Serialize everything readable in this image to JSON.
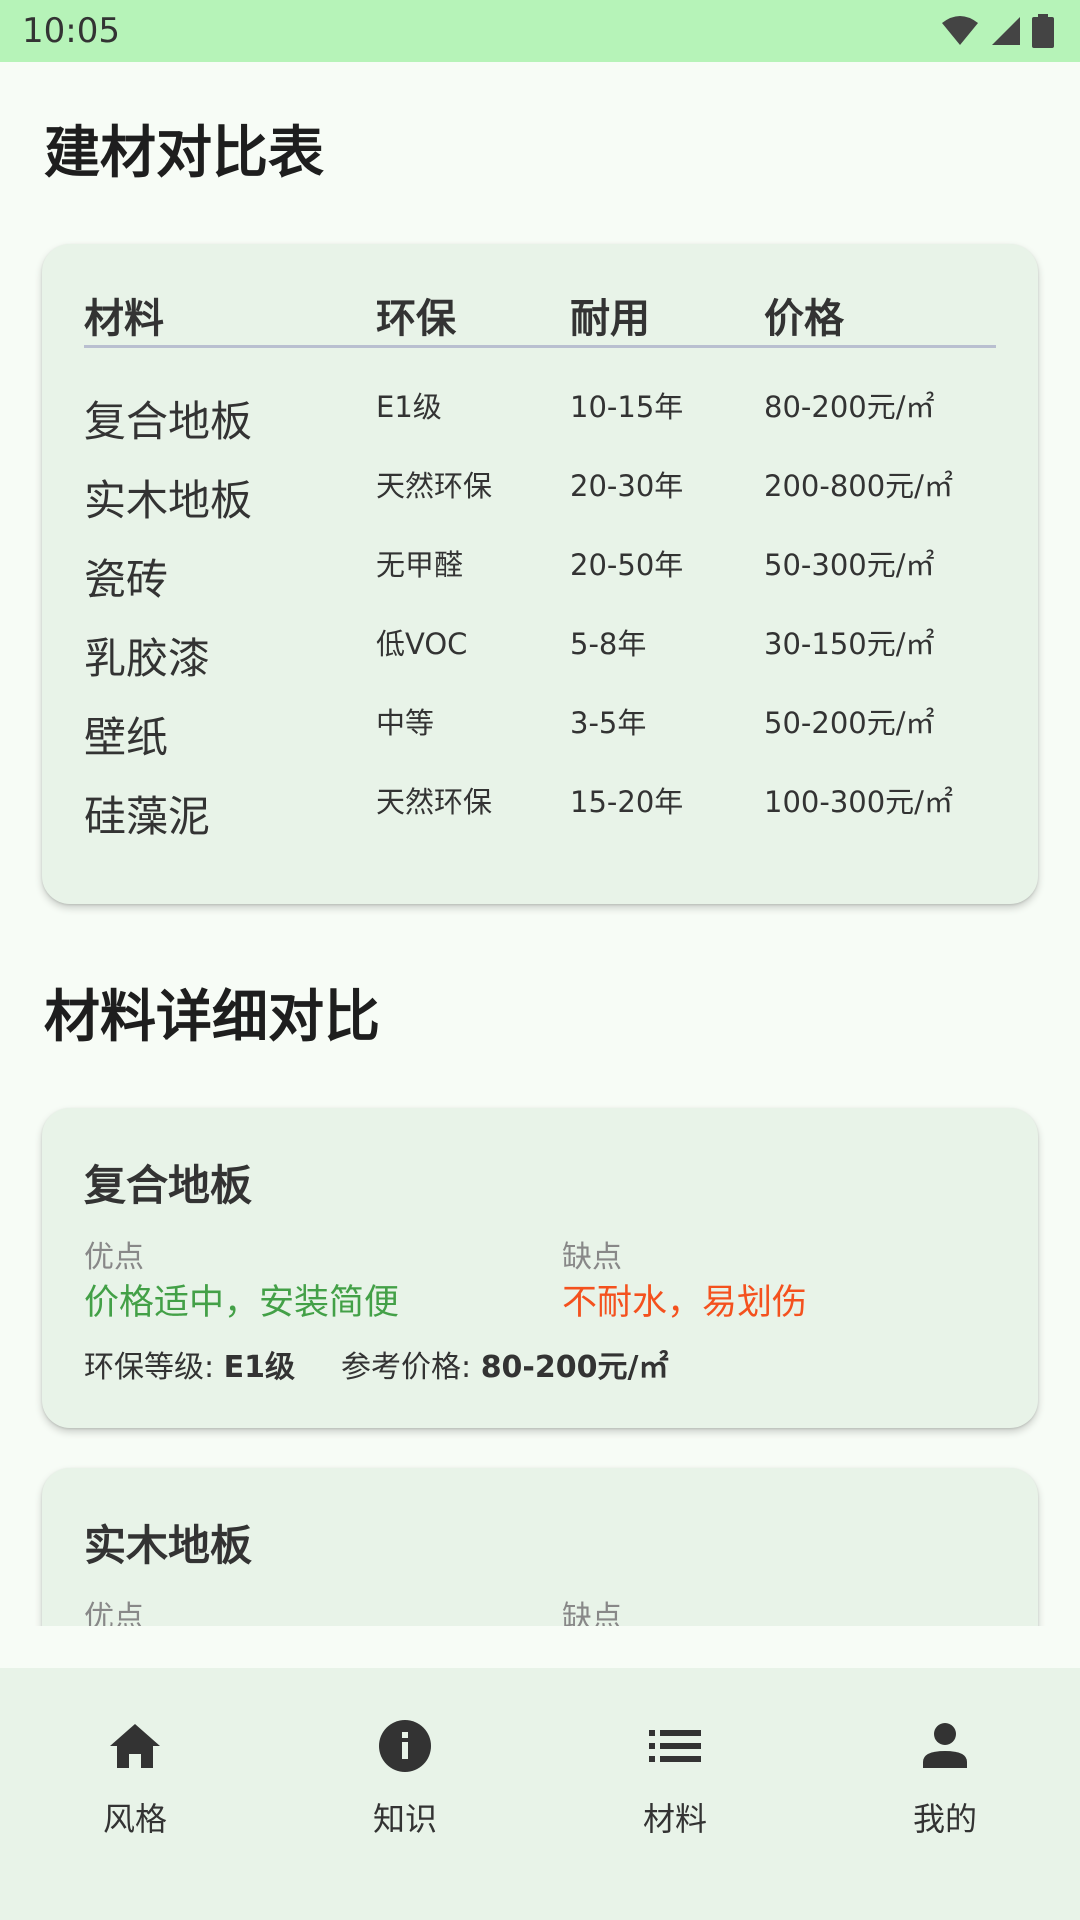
{
  "status": {
    "time": "10:05"
  },
  "table": {
    "title": "建材对比表",
    "headers": [
      "材料",
      "环保",
      "耐用",
      "价格"
    ],
    "rows": [
      [
        "复合地板",
        "E1级",
        "10-15年",
        "80-200元/㎡"
      ],
      [
        "实木地板",
        "天然环保",
        "20-30年",
        "200-800元/㎡"
      ],
      [
        "瓷砖",
        "无甲醛",
        "20-50年",
        "50-300元/㎡"
      ],
      [
        "乳胶漆",
        "低VOC",
        "5-8年",
        "30-150元/㎡"
      ],
      [
        "壁纸",
        "中等",
        "3-5年",
        "50-200元/㎡"
      ],
      [
        "硅藻泥",
        "天然环保",
        "15-20年",
        "100-300元/㎡"
      ]
    ]
  },
  "details": {
    "title": "材料详细对比",
    "cards": [
      {
        "name": "复合地板",
        "pros_label": "优点",
        "pros": "价格适中，安装简便",
        "cons_label": "缺点",
        "cons": "不耐水，易划伤",
        "eco_label": "环保等级: ",
        "eco_value": "E1级",
        "price_label": "参考价格: ",
        "price_value": "80-200元/㎡"
      },
      {
        "name": "实木地板",
        "pros_label": "优点",
        "cons_label": "缺点"
      }
    ]
  },
  "nav": {
    "items": [
      {
        "label": "风格",
        "icon": "home-icon"
      },
      {
        "label": "知识",
        "icon": "info-icon"
      },
      {
        "label": "材料",
        "icon": "list-icon"
      },
      {
        "label": "我的",
        "icon": "person-icon"
      }
    ]
  },
  "colors": {
    "status_bar": "#b6f3b8",
    "card_bg": "#e8f3e8",
    "pro_green": "#43a047",
    "con_orange": "#f4511e"
  }
}
